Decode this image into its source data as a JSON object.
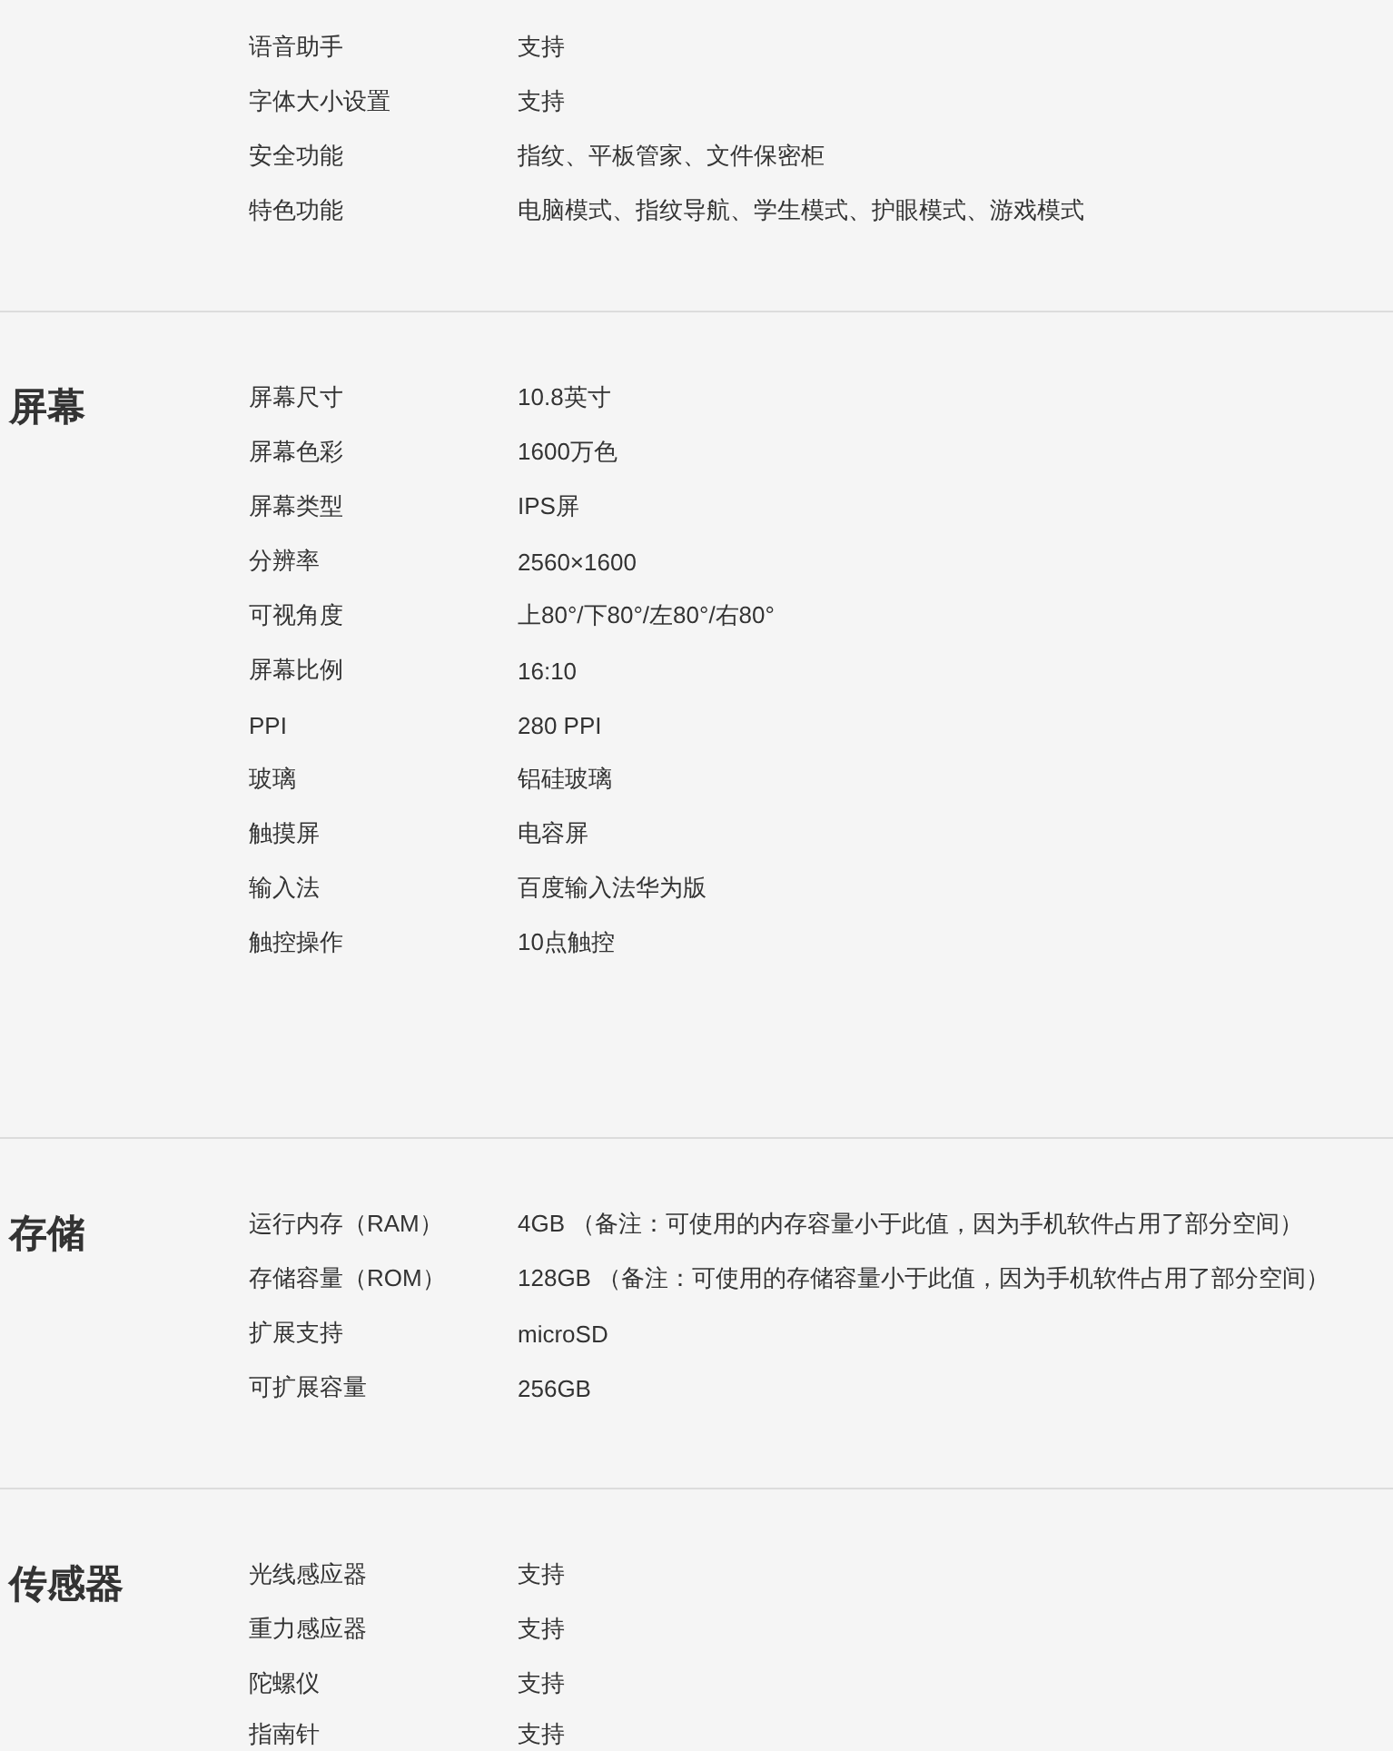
{
  "sections": [
    {
      "rows": [
        {
          "label": "语音助手",
          "value": "支持"
        },
        {
          "label": "字体大小设置",
          "value": "支持"
        },
        {
          "label": "安全功能",
          "value": "指纹、平板管家、文件保密柜"
        },
        {
          "label": "特色功能",
          "value": "电脑模式、指纹导航、学生模式、护眼模式、游戏模式"
        }
      ]
    },
    {
      "title": "屏幕",
      "rows": [
        {
          "label": "屏幕尺寸",
          "value": "10.8英寸"
        },
        {
          "label": "屏幕色彩",
          "value": "1600万色"
        },
        {
          "label": "屏幕类型",
          "value": "IPS屏"
        },
        {
          "label": "分辨率",
          "value": "2560×1600"
        },
        {
          "label": "可视角度",
          "value": "上80°/下80°/左80°/右80°"
        },
        {
          "label": "屏幕比例",
          "value": "16:10"
        },
        {
          "label": "PPI",
          "value": "280 PPI"
        },
        {
          "label": "玻璃",
          "value": "铝硅玻璃"
        },
        {
          "label": "触摸屏",
          "value": "电容屏"
        },
        {
          "label": "输入法",
          "value": "百度输入法华为版"
        },
        {
          "label": "触控操作",
          "value": "10点触控"
        }
      ]
    },
    {
      "title": "存储",
      "rows": [
        {
          "label": "运行内存（RAM）",
          "value": "4GB （备注：可使用的内存容量小于此值，因为手机软件占用了部分空间）"
        },
        {
          "label": "存储容量（ROM）",
          "value": "128GB （备注：可使用的存储容量小于此值，因为手机软件占用了部分空间）"
        },
        {
          "label": "扩展支持",
          "value": "microSD"
        },
        {
          "label": "可扩展容量",
          "value": "256GB"
        }
      ]
    },
    {
      "title": "传感器",
      "rows": [
        {
          "label": "光线感应器",
          "value": "支持"
        },
        {
          "label": "重力感应器",
          "value": "支持"
        },
        {
          "label": "陀螺仪",
          "value": "支持"
        },
        {
          "label": "指南针",
          "value": "支持"
        }
      ]
    }
  ]
}
